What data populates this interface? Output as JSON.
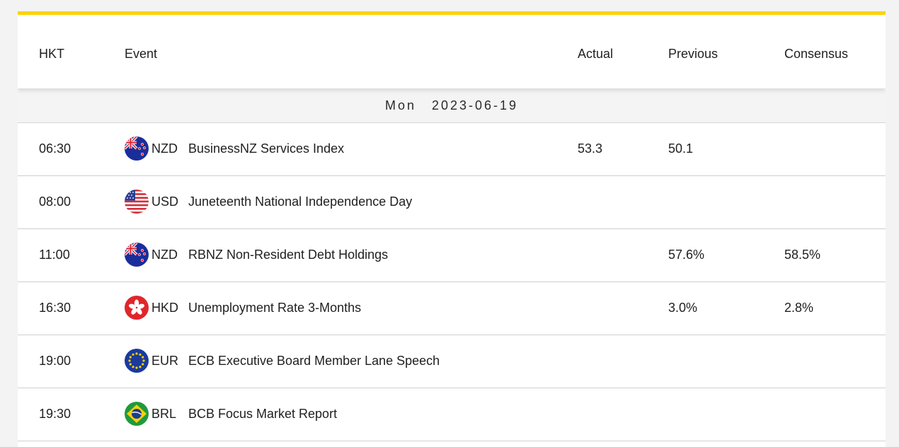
{
  "columns": {
    "time": "HKT",
    "event": "Event",
    "actual": "Actual",
    "previous": "Previous",
    "consensus": "Consensus"
  },
  "date_group": {
    "weekday": "Mon",
    "date": "2023-06-19"
  },
  "rows": [
    {
      "time": "06:30",
      "flag": "nz-flag-icon",
      "currency": "NZD",
      "event": "BusinessNZ Services Index",
      "actual": "53.3",
      "previous": "50.1",
      "consensus": ""
    },
    {
      "time": "08:00",
      "flag": "us-flag-icon",
      "currency": "USD",
      "event": "Juneteenth National Independence Day",
      "actual": "",
      "previous": "",
      "consensus": ""
    },
    {
      "time": "11:00",
      "flag": "nz-flag-icon",
      "currency": "NZD",
      "event": "RBNZ Non-Resident Debt Holdings",
      "actual": "",
      "previous": "57.6%",
      "consensus": "58.5%"
    },
    {
      "time": "16:30",
      "flag": "hk-flag-icon",
      "currency": "HKD",
      "event": "Unemployment Rate 3-Months",
      "actual": "",
      "previous": "3.0%",
      "consensus": "2.8%"
    },
    {
      "time": "19:00",
      "flag": "eu-flag-icon",
      "currency": "EUR",
      "event": "ECB Executive Board Member Lane Speech",
      "actual": "",
      "previous": "",
      "consensus": ""
    },
    {
      "time": "19:30",
      "flag": "br-flag-icon",
      "currency": "BRL",
      "event": "BCB Focus Market Report",
      "actual": "",
      "previous": "",
      "consensus": ""
    }
  ],
  "colors": {
    "accent": "#ffd200",
    "nz_blue": "#1a2d9a",
    "nz_red": "#d8202f",
    "us_red": "#d22f3a",
    "us_blue": "#2b3f93",
    "hk_red": "#e0262b",
    "eu_blue": "#1b3a9c",
    "eu_gold": "#ffd200",
    "br_green": "#1f9a3c",
    "br_yellow": "#f5d10c",
    "br_blue": "#1d3c8c"
  }
}
